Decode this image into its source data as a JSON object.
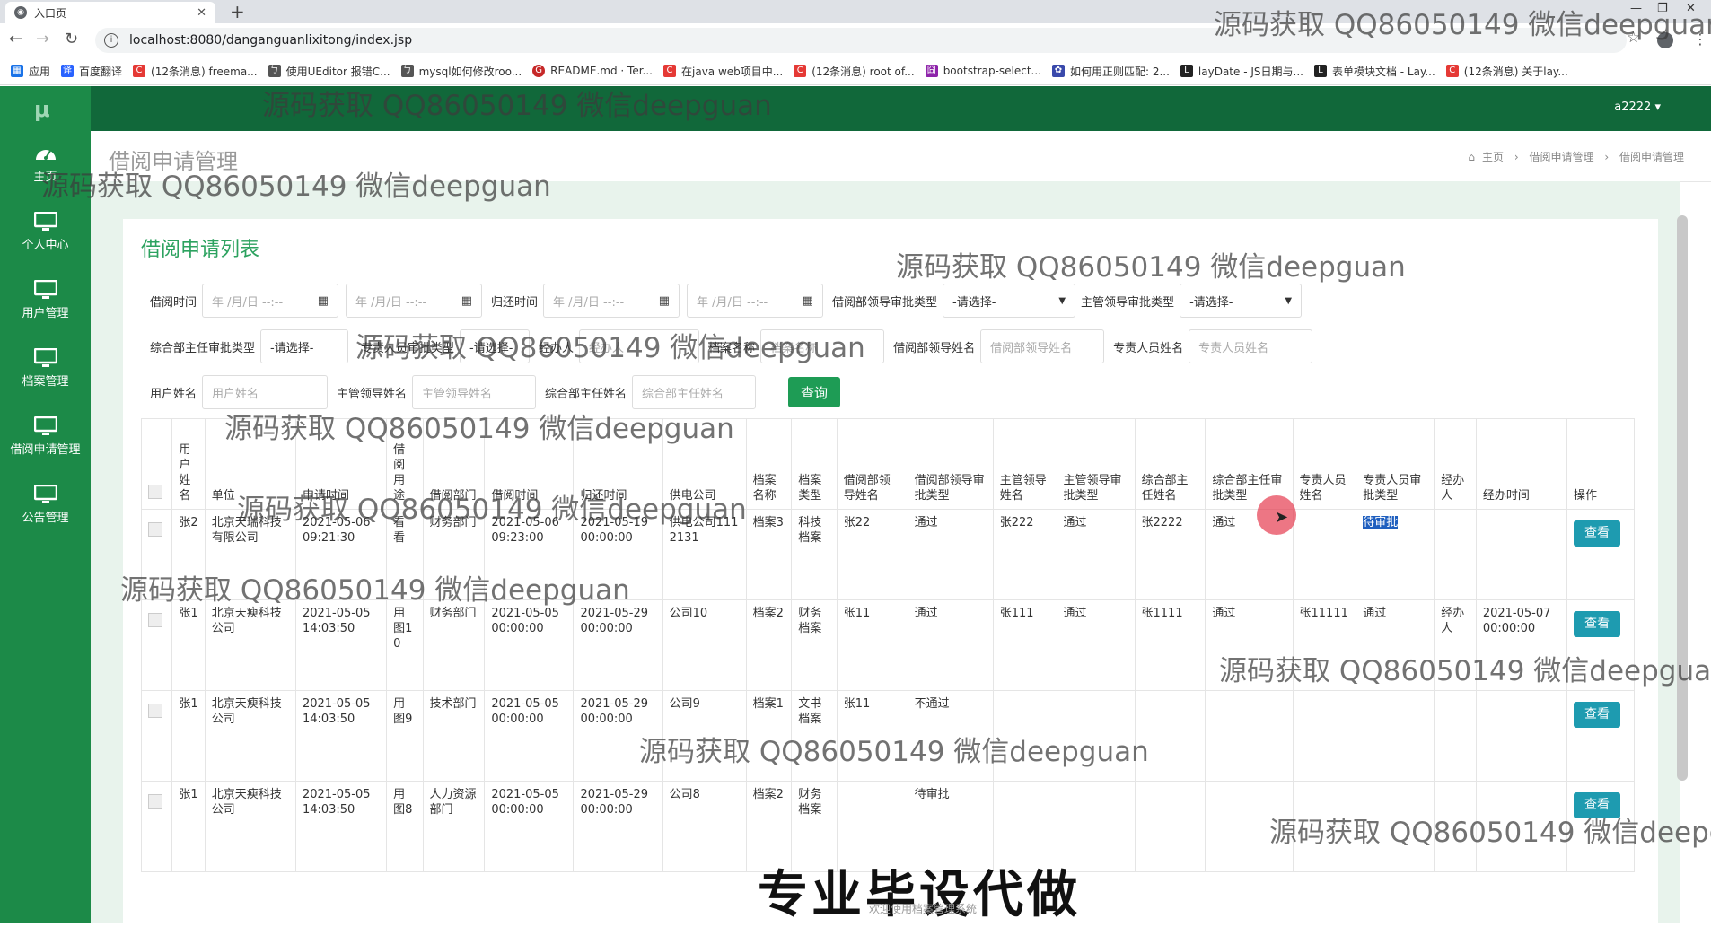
{
  "browser": {
    "tab_title": "入口页",
    "url": "localhost:8080/danganguanlixitong/index.jsp",
    "bookmarks": [
      {
        "label": "应用",
        "color": "#1a73e8"
      },
      {
        "label": "百度翻译",
        "color": "#2962ff"
      },
      {
        "label": "(12条消息) freema...",
        "color": "#e53935"
      },
      {
        "label": "使用UEditor 报错C...",
        "color": "#555555"
      },
      {
        "label": "mysql如何修改roo...",
        "color": "#555555"
      },
      {
        "label": "README.md · Ter...",
        "color": "#c62828"
      },
      {
        "label": "在java web项目中...",
        "color": "#e53935"
      },
      {
        "label": "(12条消息) root of...",
        "color": "#e53935"
      },
      {
        "label": "bootstrap-select...",
        "color": "#8e24aa"
      },
      {
        "label": "如何用正则匹配: 2...",
        "color": "#3949ab"
      },
      {
        "label": "layDate - JS日期与...",
        "color": "#222222"
      },
      {
        "label": "表单模块文档 - Lay...",
        "color": "#222222"
      },
      {
        "label": "(12条消息) 关于lay...",
        "color": "#e53935"
      }
    ]
  },
  "app": {
    "logo": "μ",
    "user": "a2222 ▾",
    "sidebar": [
      {
        "label": "主页",
        "icon": "dashboard-icon"
      },
      {
        "label": "个人中心",
        "icon": "monitor-icon"
      },
      {
        "label": "用户管理",
        "icon": "monitor-icon"
      },
      {
        "label": "档案管理",
        "icon": "monitor-icon"
      },
      {
        "label": "借阅申请管理",
        "icon": "monitor-icon"
      },
      {
        "label": "公告管理",
        "icon": "monitor-icon"
      }
    ],
    "page_title": "借阅申请管理",
    "breadcrumb": [
      "主页",
      "借阅申请管理",
      "借阅申请管理"
    ],
    "card_title": "借阅申请列表"
  },
  "filters": {
    "borrow_time_label": "借阅时间",
    "return_time_label": "归还时间",
    "date_placeholder": "年 /月/日 --:--",
    "borrow_dept_leader_approval_label": "借阅部领导审批类型",
    "supervisor_approval_label": "主管领导审批类型",
    "general_director_approval_label": "综合部主任审批类型",
    "staff_approval_label": "专责人员审批类型",
    "handler_label": "经办人",
    "select_placeholder": "-请选择-",
    "archive_name_label": "档案名称",
    "archive_name_placeholder": "档案名称",
    "borrow_dept_leader_name_label": "借阅部领导姓名",
    "borrow_dept_leader_name_placeholder": "借阅部领导姓名",
    "staff_name_label": "专责人员姓名",
    "staff_name_placeholder": "专责人员姓名",
    "user_name_label": "用户姓名",
    "user_name_placeholder": "用户姓名",
    "supervisor_name_label": "主管领导姓名",
    "supervisor_name_placeholder": "主管领导姓名",
    "general_director_name_label": "综合部主任姓名",
    "general_director_name_placeholder": "综合部主任姓名",
    "query_button": "查询"
  },
  "table": {
    "headers": [
      "用户姓名",
      "单位",
      "申请时间",
      "借阅用途",
      "借阅部门",
      "借阅时间",
      "归还时间",
      "供电公司",
      "档案名称",
      "档案类型",
      "借阅部领导姓名",
      "借阅部领导审批类型",
      "主管领导姓名",
      "主管领导审批类型",
      "综合部主任姓名",
      "综合部主任审批类型",
      "专责人员姓名",
      "专责人员审批类型",
      "经办人",
      "经办时间",
      "操作"
    ],
    "view_button": "查看",
    "rows": [
      [
        "张2",
        "北京天瑞科技有限公司",
        "2021-05-06 09:21:30",
        "看看",
        "财务部门",
        "2021-05-06 09:23:00",
        "2021-05-19 00:00:00",
        "供电公司1112131",
        "档案3",
        "科技档案",
        "张22",
        "通过",
        "张222",
        "通过",
        "张2222",
        "通过",
        "",
        "待审批",
        "",
        ""
      ],
      [
        "张1",
        "北京天瘐科技公司",
        "2021-05-05 14:03:50",
        "用图10",
        "财务部门",
        "2021-05-05 00:00:00",
        "2021-05-29 00:00:00",
        "公司10",
        "档案2",
        "财务档案",
        "张11",
        "通过",
        "张111",
        "通过",
        "张1111",
        "通过",
        "张11111",
        "通过",
        "经办人",
        "2021-05-07 00:00:00"
      ],
      [
        "张1",
        "北京天瘐科技公司",
        "2021-05-05 14:03:50",
        "用图9",
        "技术部门",
        "2021-05-05 00:00:00",
        "2021-05-29 00:00:00",
        "公司9",
        "档案1",
        "文书档案",
        "张11",
        "不通过",
        "",
        "",
        "",
        "",
        "",
        "",
        "",
        ""
      ],
      [
        "张1",
        "北京天瘐科技公司",
        "2021-05-05 14:03:50",
        "用图8",
        "人力资源部门",
        "2021-05-05 00:00:00",
        "2021-05-29 00:00:00",
        "公司8",
        "档案2",
        "财务档案",
        "",
        "待审批",
        "",
        "",
        "",
        "",
        "",
        "",
        "",
        ""
      ]
    ]
  },
  "overlay": {
    "watermark": "源码获取 QQ86050149 微信deepguan",
    "watermark_partial": "源码获取 QQ86050149 微信deepgu",
    "caption": "专业毕设代做",
    "footer_note": "欢迎使用档案管理系统"
  }
}
